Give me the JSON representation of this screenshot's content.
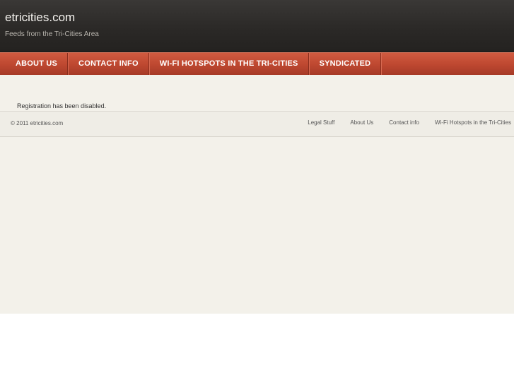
{
  "header": {
    "site_title": "etricities.com",
    "site_description": "Feeds from the Tri-Cities Area"
  },
  "nav": {
    "items": [
      {
        "label": "About Us"
      },
      {
        "label": "Contact Info"
      },
      {
        "label": "Wi-Fi Hotspots in the Tri-Cities"
      },
      {
        "label": "Syndicated"
      }
    ]
  },
  "main": {
    "notice": "Registration has been disabled."
  },
  "footer": {
    "copyright": "© 2011 etricities.com",
    "links": [
      {
        "label": "Legal Stuff"
      },
      {
        "label": "About Us"
      },
      {
        "label": "Contact info"
      },
      {
        "label": "Wi-Fi Hotspots in the Tri-Cities"
      }
    ]
  },
  "colors": {
    "header_bg": "#2b2927",
    "nav_bg": "#bd4730",
    "content_bg": "#f3f1ea",
    "page_bg": "#ffffff"
  }
}
